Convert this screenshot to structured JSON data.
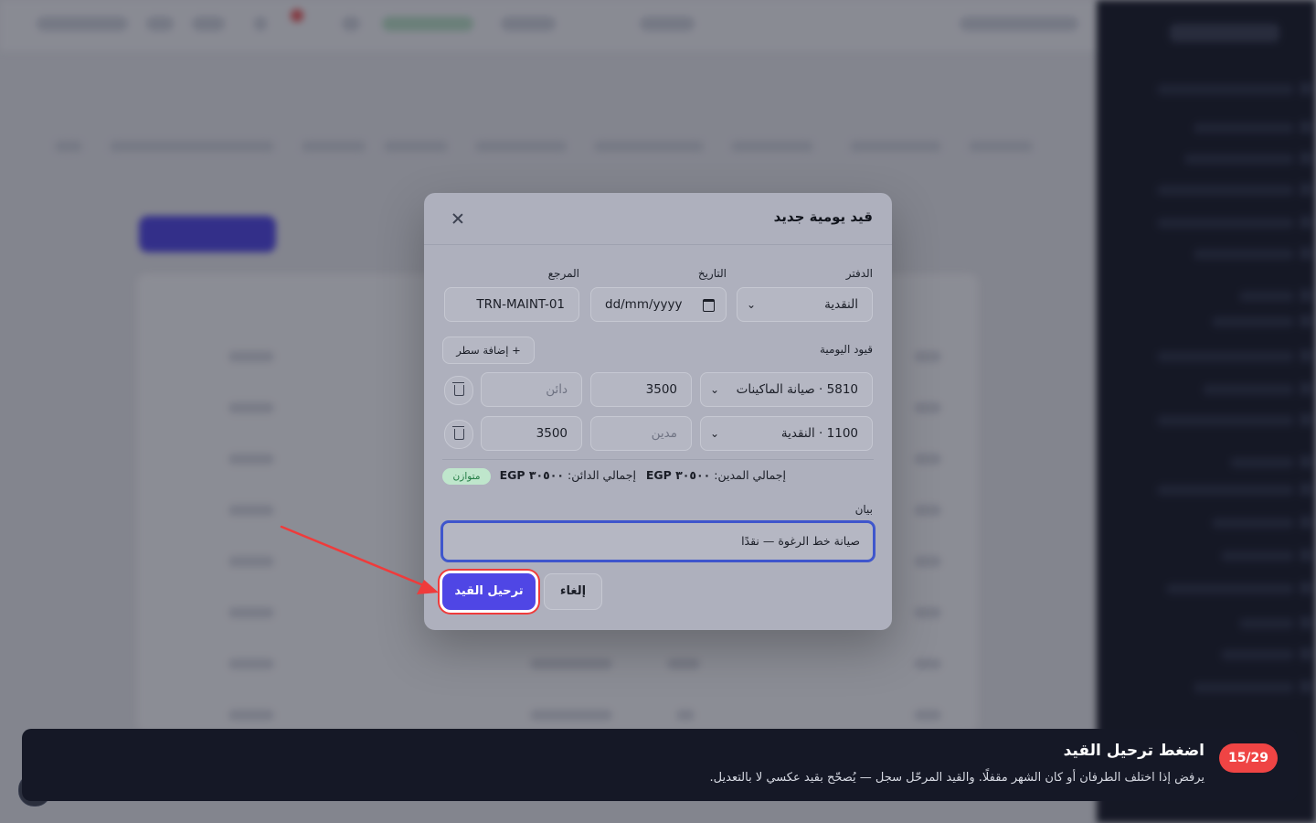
{
  "modal": {
    "title": "قيد يومية جديد",
    "fields": {
      "journal": {
        "label": "الدفتر",
        "value": "النقدية"
      },
      "date": {
        "label": "التاريخ",
        "placeholder": "dd/mm/yyyy"
      },
      "reference": {
        "label": "المرجع",
        "value": "TRN-MAINT-01"
      }
    },
    "lines_section": {
      "label": "قيود اليومية",
      "add_line_label": "+ إضافة سطر",
      "lines": [
        {
          "account": "5810 · صيانة الماكينات",
          "debit": "3500",
          "credit_placeholder": "دائن"
        },
        {
          "account": "1100 · النقدية",
          "debit_placeholder": "مدين",
          "credit": "3500"
        }
      ]
    },
    "totals": {
      "debit_label": "إجمالي المدين:",
      "debit_value": "EGP ٣٠٥٠٠",
      "credit_label": "إجمالي الدائن:",
      "credit_value": "EGP ٣٠٥٠٠",
      "balance_badge": "متوازن"
    },
    "memo": {
      "label": "بيان",
      "value": "صيانة خط الرغوة — نقدًا"
    },
    "buttons": {
      "cancel": "إلغاء",
      "post": "ترحيل القيد"
    }
  },
  "tour": {
    "step": "15/29",
    "title": "اضغط ترحيل القيد",
    "description": "يرفض إذا اختلف الطرفان أو كان الشهر مقفلًا. والقيد المرحّل سجل — يُصحّح بقيد عكسي لا بالتعديل."
  },
  "colors": {
    "primary": "#4f46e5",
    "highlight": "#ef3b3b",
    "balanced": "#bfe6cc"
  }
}
